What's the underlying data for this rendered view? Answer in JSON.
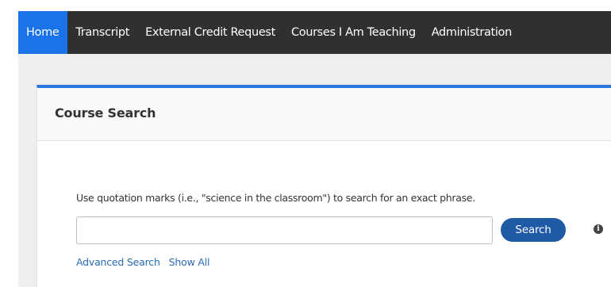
{
  "nav": {
    "items": [
      {
        "label": "Home",
        "active": true
      },
      {
        "label": "Transcript",
        "active": false
      },
      {
        "label": "External Credit Request",
        "active": false
      },
      {
        "label": "Courses I Am Teaching",
        "active": false
      },
      {
        "label": "Administration",
        "active": false
      }
    ]
  },
  "card": {
    "title": "Course Search",
    "hint": "Use quotation marks (i.e., \"science in the classroom\") to search for an exact phrase.",
    "search": {
      "value": "",
      "placeholder": "",
      "button_label": "Search",
      "info_icon": "info-icon"
    },
    "links": {
      "advanced": "Advanced Search",
      "show_all": "Show All"
    }
  },
  "colors": {
    "nav_bg": "#2f3030",
    "nav_active": "#1a73e8",
    "accent": "#2b75de",
    "button": "#1f5aa6",
    "link": "#2a6bb8"
  }
}
